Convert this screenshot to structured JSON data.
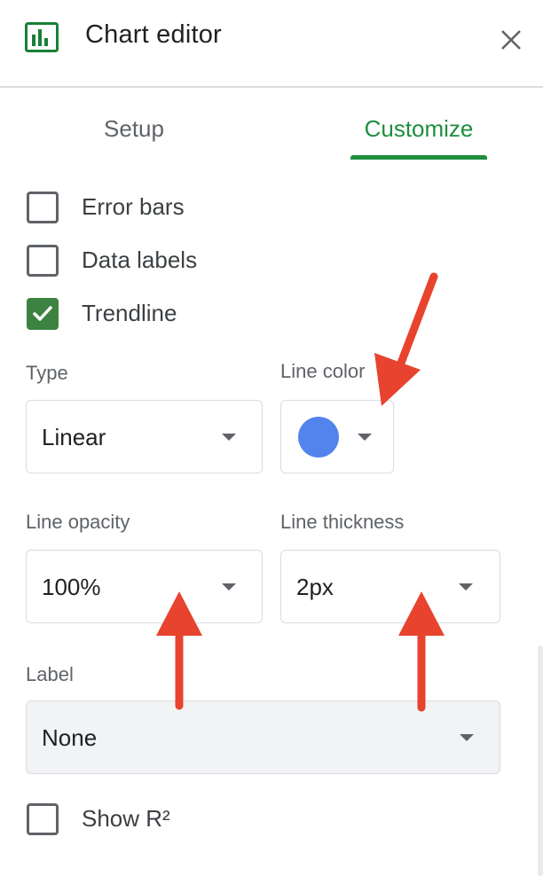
{
  "header": {
    "title": "Chart editor",
    "app_icon": "bar-chart-icon",
    "close_icon": "close-icon"
  },
  "tabs": [
    {
      "label": "Setup",
      "active": false
    },
    {
      "label": "Customize",
      "active": true
    }
  ],
  "checkboxes": [
    {
      "label": "Error bars",
      "checked": false
    },
    {
      "label": "Data labels",
      "checked": false
    },
    {
      "label": "Trendline",
      "checked": true
    }
  ],
  "fields": {
    "type": {
      "label": "Type",
      "value": "Linear"
    },
    "line_color": {
      "label": "Line color",
      "value_color": "#5383ec"
    },
    "line_opacity": {
      "label": "Line opacity",
      "value": "100%"
    },
    "line_thickness": {
      "label": "Line thickness",
      "value": "2px"
    },
    "label": {
      "label": "Label",
      "value": "None"
    }
  },
  "show_r2": {
    "label": "Show R²",
    "checked": false
  },
  "colors": {
    "accent": "#1e8e3e",
    "checkbox_checked": "#3c8341",
    "annotation_arrow": "#e8432e"
  }
}
